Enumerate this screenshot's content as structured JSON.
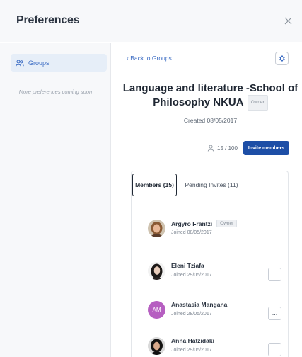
{
  "header": {
    "title": "Preferences",
    "close_icon": "close-icon"
  },
  "sidebar": {
    "items": [
      {
        "label": "Groups",
        "icon": "groups-icon",
        "active": true
      }
    ],
    "note": "More preferences coming soon"
  },
  "main": {
    "back_label": "‹ Back to Groups",
    "settings_icon": "gear-icon",
    "group_title": "Language and literature -School of Philosophy NKUA",
    "owner_badge": "Owner",
    "created": "Created 08/05/2017",
    "member_count": "15 / 100",
    "invite_label": "Invite members",
    "colors": {
      "accent": "#1d4ea6",
      "link": "#3a6bc3",
      "initials_avatar": "#b65fc1"
    }
  },
  "tabs": [
    {
      "label": "Members (15)",
      "active": true
    },
    {
      "label": "Pending Invites (11)",
      "active": false
    }
  ],
  "members": [
    {
      "name": "Argyro Frantzi",
      "joined": "Joined 08/05/2017",
      "badge": "Owner",
      "avatar": "photo"
    },
    {
      "name": "Eleni Tziafa",
      "joined": "Joined 29/05/2017",
      "badge": "",
      "avatar": "photo",
      "more": "..."
    },
    {
      "name": "Anastasia Mangana",
      "joined": "Joined 28/05/2017",
      "badge": "",
      "avatar": "initials",
      "initials": "AM",
      "more": "..."
    },
    {
      "name": "Anna Hatzidaki",
      "joined": "Joined 29/05/2017",
      "badge": "",
      "avatar": "photo",
      "more": "..."
    }
  ]
}
